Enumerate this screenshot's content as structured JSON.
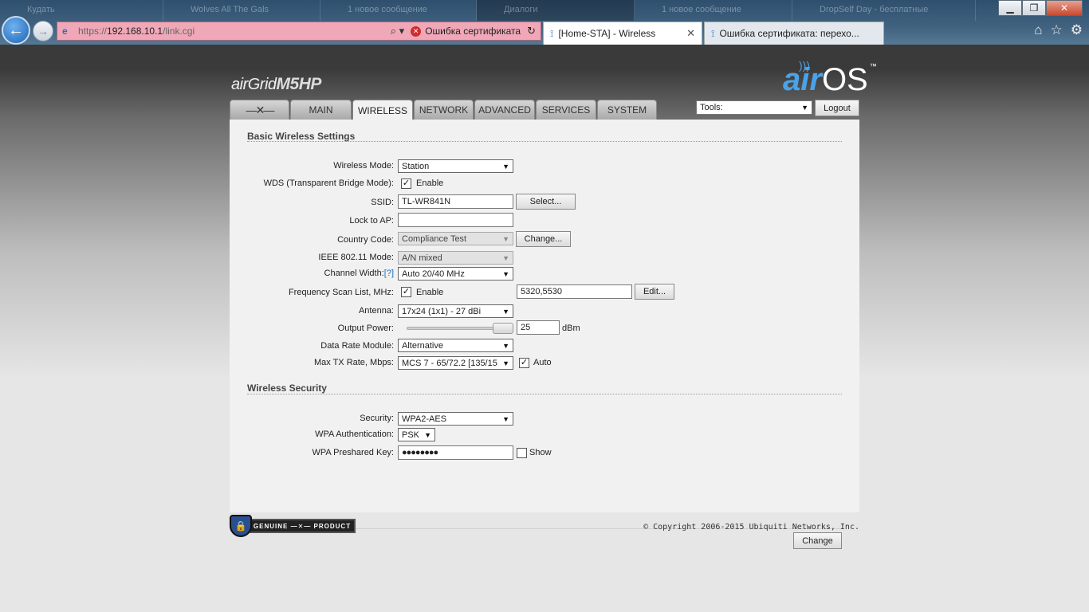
{
  "browser": {
    "ghost_tabs": [
      "Кудать",
      "Wolves All The Gals",
      "1 новое сообщение",
      "Диалоги",
      "1 новое сообщение",
      "DropSelf Day - бесплатные"
    ],
    "address": {
      "url_prefix": "https://",
      "url_host": "192.168.10.1",
      "url_path": "/link.cgi",
      "cert_error": "Ошибка сертификата",
      "search_glyph": "⌕ ▾"
    },
    "tabs": [
      {
        "title": "[Home-STA] - Wireless",
        "active": true
      },
      {
        "title": "Ошибка сертификата: перехо...",
        "active": false
      }
    ],
    "window_buttons": [
      "▁",
      "❐",
      "✕"
    ],
    "toolbar_icons": [
      "⌂",
      "☆",
      "⚙"
    ]
  },
  "header": {
    "product_prefix": "airGrid",
    "product_model": "M5HP",
    "os_prefix": "air",
    "os_name": "OS",
    "os_tm": "™",
    "tabs": [
      {
        "label": "✕ubnt",
        "active": false
      },
      {
        "label": "MAIN",
        "active": false
      },
      {
        "label": "WIRELESS",
        "active": true
      },
      {
        "label": "NETWORK",
        "active": false
      },
      {
        "label": "ADVANCED",
        "active": false
      },
      {
        "label": "SERVICES",
        "active": false
      },
      {
        "label": "SYSTEM",
        "active": false
      }
    ],
    "tools_label": "Tools:",
    "logout_label": "Logout"
  },
  "basic": {
    "title": "Basic Wireless Settings",
    "wireless_mode": {
      "label": "Wireless Mode:",
      "value": "Station"
    },
    "wds": {
      "label": "WDS (Transparent Bridge Mode):",
      "checked": true,
      "check_label": "Enable"
    },
    "ssid": {
      "label": "SSID:",
      "value": "TL-WR841N",
      "button": "Select..."
    },
    "lock_ap": {
      "label": "Lock to AP:",
      "value": ""
    },
    "country": {
      "label": "Country Code:",
      "value": "Compliance Test",
      "button": "Change..."
    },
    "ieee": {
      "label": "IEEE 802.11 Mode:",
      "value": "A/N mixed"
    },
    "channel_width": {
      "label": "Channel Width:",
      "help": "[?]",
      "value": "Auto 20/40 MHz"
    },
    "freq_scan": {
      "label": "Frequency Scan List, MHz:",
      "checked": true,
      "check_label": "Enable",
      "value": "5320,5530",
      "button": "Edit..."
    },
    "antenna": {
      "label": "Antenna:",
      "value": "17x24 (1x1) - 27 dBi"
    },
    "output_power": {
      "label": "Output Power:",
      "value": "25",
      "unit": "dBm",
      "slider_fraction": 1.0
    },
    "data_rate": {
      "label": "Data Rate Module:",
      "value": "Alternative"
    },
    "max_tx": {
      "label": "Max TX Rate, Mbps:",
      "value": "MCS 7 - 65/72.2 [135/15",
      "checked": true,
      "check_label": "Auto"
    }
  },
  "security": {
    "title": "Wireless Security",
    "security": {
      "label": "Security:",
      "value": "WPA2-AES"
    },
    "wpa_auth": {
      "label": "WPA Authentication:",
      "value": "PSK"
    },
    "psk": {
      "label": "WPA Preshared Key:",
      "value": "●●●●●●●●",
      "checked": false,
      "check_label": "Show"
    }
  },
  "footer": {
    "change_label": "Change",
    "badge_left": "GENUINE",
    "badge_right": "PRODUCT",
    "copyright": "© Copyright 2006-2015 Ubiquiti Networks, Inc."
  },
  "colors": {
    "accent": "#4aa3e8",
    "cert_error": "#f0a8b8",
    "help_link": "#1a6fc8"
  }
}
